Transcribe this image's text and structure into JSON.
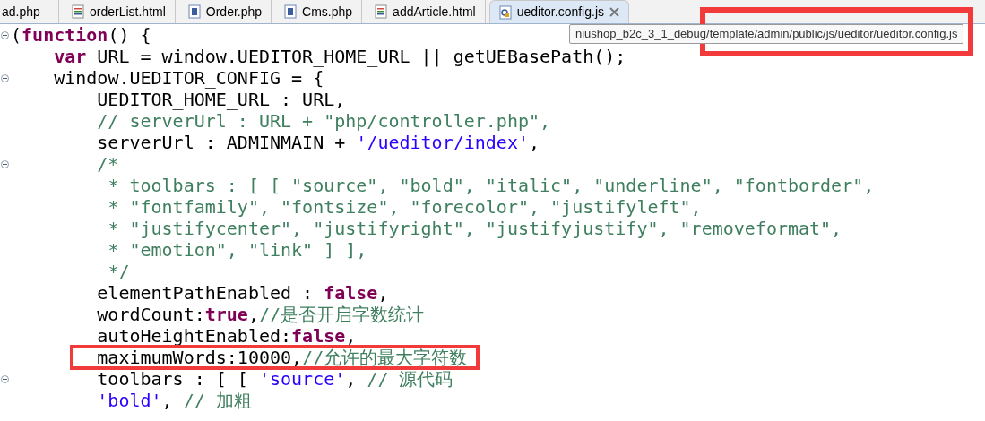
{
  "tabs": [
    {
      "label": "ad.php",
      "selected": false,
      "closable": false
    },
    {
      "label": "orderList.html",
      "kind": "html",
      "selected": false,
      "closable": false
    },
    {
      "label": "Order.php",
      "kind": "php",
      "selected": false,
      "closable": false
    },
    {
      "label": "Cms.php",
      "kind": "php",
      "selected": false,
      "closable": false
    },
    {
      "label": "addArticle.html",
      "kind": "html",
      "selected": false,
      "closable": false
    },
    {
      "label": "ueditor.config.js",
      "kind": "js",
      "selected": true,
      "closable": true
    }
  ],
  "tooltip": "niushop_b2c_3_1_debug/template/admin/public/js/ueditor/ueditor.config.js",
  "code_lines": [
    {
      "fold_marker": true,
      "highlighted": false,
      "tokens": [
        {
          "kind": "plain",
          "text": "("
        },
        {
          "kind": "keyword",
          "text": "function"
        },
        {
          "kind": "plain",
          "text": "() {"
        }
      ]
    },
    {
      "fold_marker": false,
      "highlighted": false,
      "tokens": [
        {
          "kind": "keyword",
          "text": "    var"
        },
        {
          "kind": "plain",
          "text": " URL = window.UEDITOR_HOME_URL || getUEBasePath();"
        }
      ]
    },
    {
      "fold_marker": true,
      "highlighted": false,
      "tokens": [
        {
          "kind": "plain",
          "text": "    window.UEDITOR_CONFIG = {"
        }
      ]
    },
    {
      "fold_marker": false,
      "highlighted": false,
      "tokens": [
        {
          "kind": "plain",
          "text": "        UEDITOR_HOME_URL : URL,"
        }
      ]
    },
    {
      "fold_marker": false,
      "highlighted": false,
      "tokens": [
        {
          "kind": "comment",
          "text": "        // serverUrl : URL + \"php/controller.php\","
        }
      ]
    },
    {
      "fold_marker": false,
      "highlighted": false,
      "tokens": [
        {
          "kind": "plain",
          "text": "        serverUrl : ADMINMAIN + "
        },
        {
          "kind": "string",
          "text": "'/ueditor/index'"
        },
        {
          "kind": "plain",
          "text": ","
        }
      ]
    },
    {
      "fold_marker": true,
      "highlighted": false,
      "tokens": [
        {
          "kind": "comment",
          "text": "        /*"
        }
      ]
    },
    {
      "fold_marker": false,
      "highlighted": false,
      "tokens": [
        {
          "kind": "comment",
          "text": "         * toolbars : [ [ \"source\", \"bold\", \"italic\", \"underline\", \"fontborder\","
        }
      ]
    },
    {
      "fold_marker": false,
      "highlighted": false,
      "tokens": [
        {
          "kind": "comment",
          "text": "         * \"fontfamily\", \"fontsize\", \"forecolor\", \"justifyleft\","
        }
      ]
    },
    {
      "fold_marker": false,
      "highlighted": false,
      "tokens": [
        {
          "kind": "comment",
          "text": "         * \"justifycenter\", \"justifyright\", \"justifyjustify\", \"removeformat\","
        }
      ]
    },
    {
      "fold_marker": false,
      "highlighted": false,
      "tokens": [
        {
          "kind": "comment",
          "text": "         * \"emotion\", \"link\" ] ],"
        }
      ]
    },
    {
      "fold_marker": false,
      "highlighted": false,
      "tokens": [
        {
          "kind": "comment",
          "text": "         */"
        }
      ]
    },
    {
      "fold_marker": false,
      "highlighted": false,
      "tokens": [
        {
          "kind": "plain",
          "text": "        elementPathEnabled : "
        },
        {
          "kind": "keyword",
          "text": "false"
        },
        {
          "kind": "plain",
          "text": ","
        }
      ]
    },
    {
      "fold_marker": false,
      "highlighted": false,
      "tokens": [
        {
          "kind": "plain",
          "text": "        wordCount:"
        },
        {
          "kind": "keyword",
          "text": "true"
        },
        {
          "kind": "plain",
          "text": ","
        },
        {
          "kind": "comment",
          "text": "//是否开启字数统计"
        }
      ]
    },
    {
      "fold_marker": false,
      "highlighted": false,
      "tokens": [
        {
          "kind": "plain",
          "text": "        autoHeightEnabled:"
        },
        {
          "kind": "keyword",
          "text": "false"
        },
        {
          "kind": "plain",
          "text": ","
        }
      ]
    },
    {
      "fold_marker": false,
      "highlighted": true,
      "tokens": [
        {
          "kind": "plain",
          "text": "        maximumWords:10000,"
        },
        {
          "kind": "comment",
          "text": "//允许的最大字符数"
        }
      ]
    },
    {
      "fold_marker": true,
      "highlighted": false,
      "tokens": [
        {
          "kind": "plain",
          "text": "        toolbars : [ [ "
        },
        {
          "kind": "string",
          "text": "'source'"
        },
        {
          "kind": "plain",
          "text": ", "
        },
        {
          "kind": "comment",
          "text": "// 源代码"
        }
      ]
    },
    {
      "fold_marker": false,
      "highlighted": false,
      "tokens": [
        {
          "kind": "string",
          "text": "        'bold'"
        },
        {
          "kind": "plain",
          "text": ", "
        },
        {
          "kind": "comment",
          "text": "// 加粗"
        }
      ]
    }
  ]
}
